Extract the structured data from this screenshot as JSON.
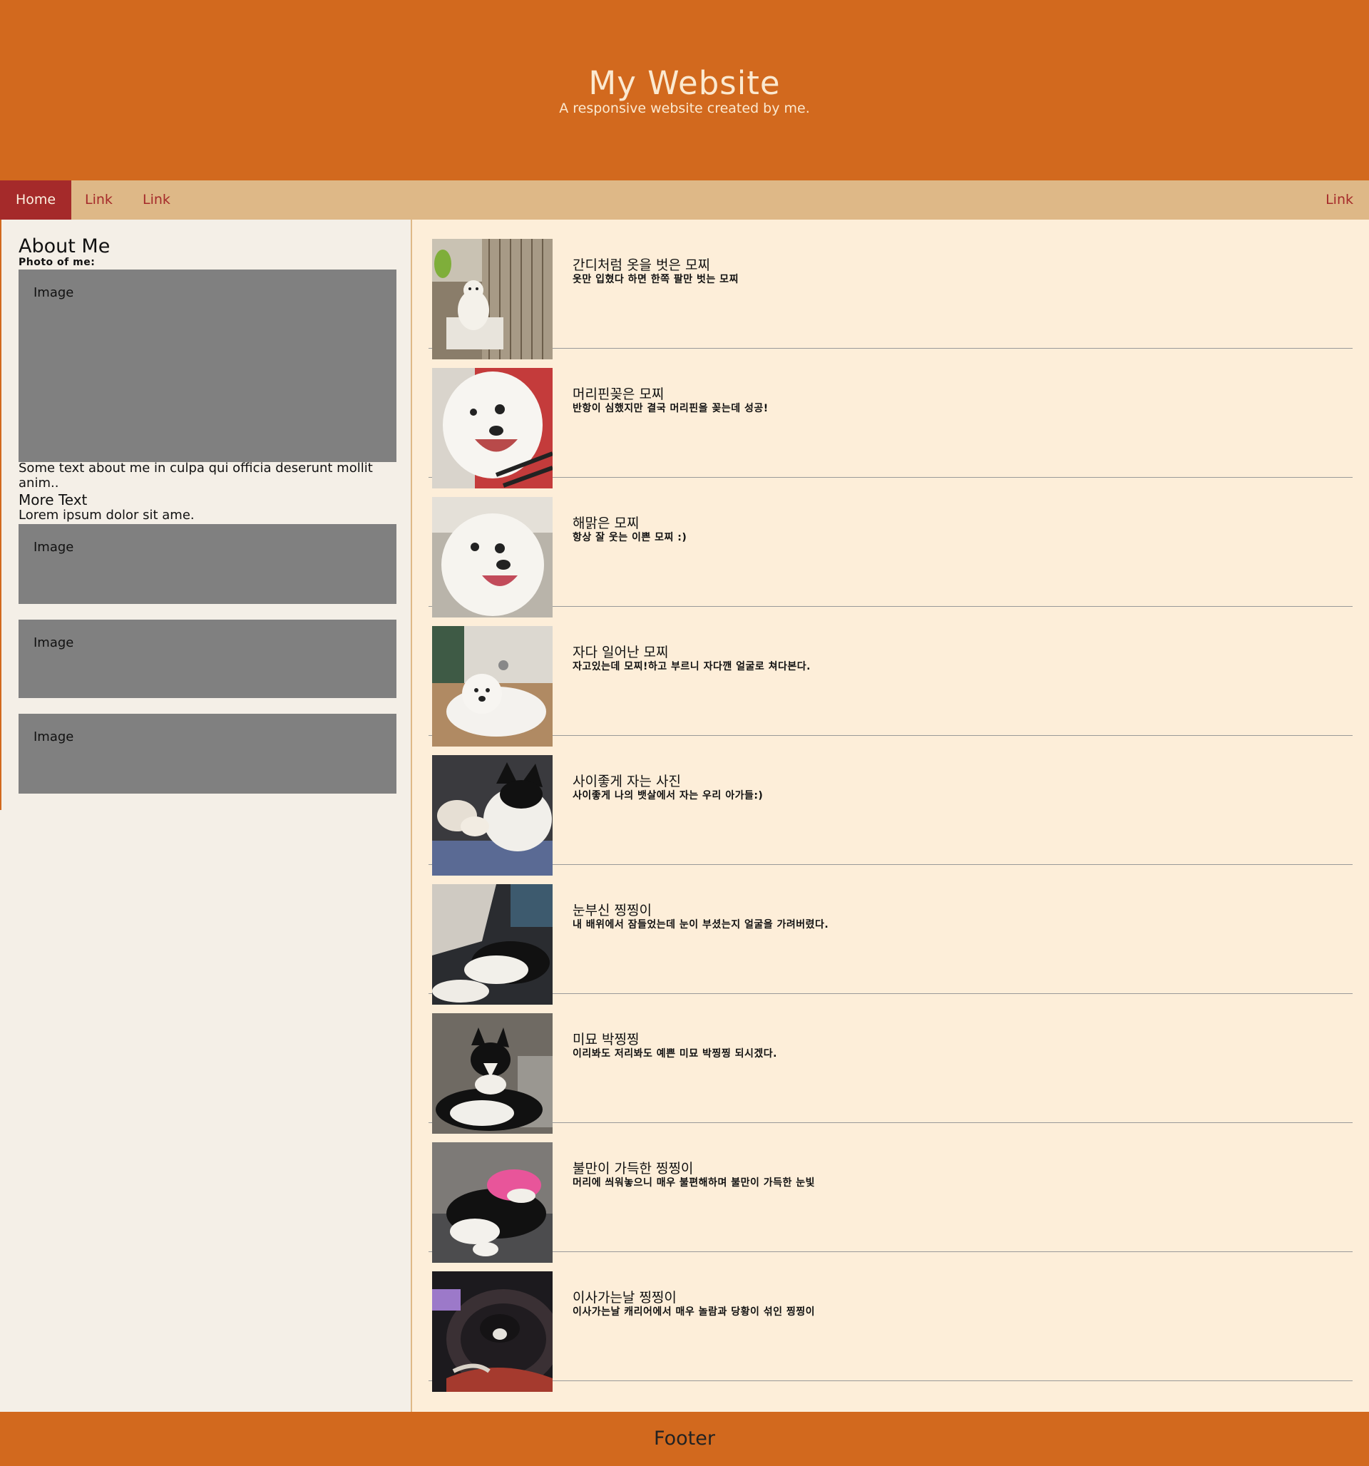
{
  "header": {
    "title": "My Website",
    "subtitle": "A responsive website created by me."
  },
  "nav": {
    "items": [
      "Home",
      "Link",
      "Link"
    ],
    "right_item": "Link"
  },
  "sidebar": {
    "heading": "About Me",
    "photo_label": "Photo of me:",
    "image_label": "Image",
    "about_text": "Some text about me in culpa qui officia deserunt mollit anim..",
    "more_heading": "More Text",
    "more_text": "Lorem ipsum dolor sit ame.",
    "extra_images": [
      "Image",
      "Image",
      "Image"
    ]
  },
  "posts": [
    {
      "title": "간디처럼 옷을 벗은 모찌",
      "caption": "옷만 입혔다 하면 한쪽 팔만 벗는 모찌",
      "photo": "white puppy in cage"
    },
    {
      "title": "머리핀꽂은 모찌",
      "caption": "반항이 심했지만 결국 머리핀을 꽂는데 성공!",
      "photo": "white puppy with hairpin"
    },
    {
      "title": "해맑은 모찌",
      "caption": "항상 잘 웃는 이쁜 모찌 :)",
      "photo": "smiling white puppy"
    },
    {
      "title": "자다 일어난 모찌",
      "caption": "자고있는데 모찌!하고 부르니 자다깬 얼굴로 쳐다본다.",
      "photo": "sleepy white puppy"
    },
    {
      "title": "사이좋게 자는 사진",
      "caption": "사이좋게 나의 뱃살에서 자는 우리 아가들:)",
      "photo": "puppy and cat sleeping"
    },
    {
      "title": "눈부신 찡찡이",
      "caption": "내 배위에서 잠들었는데 눈이 부셨는지 얼굴을 가려버렸다.",
      "photo": "cat covering face"
    },
    {
      "title": "미묘 박찡찡",
      "caption": "이리봐도 저리봐도 예쁜 미묘 박찡찡 되시겠다.",
      "photo": "black and white cat"
    },
    {
      "title": "불만이 가득한 찡찡이",
      "caption": "머리에 씌워놓으니 매우 불편해하며 불만이 가득한 눈빛",
      "photo": "cat with pink hat"
    },
    {
      "title": "이사가는날 찡찡이",
      "caption": "이사가는날 캐리어에서 매우 놀람과 당황이 섞인 찡찡이",
      "photo": "cat in carrier"
    }
  ],
  "footer": {
    "text": "Footer"
  }
}
